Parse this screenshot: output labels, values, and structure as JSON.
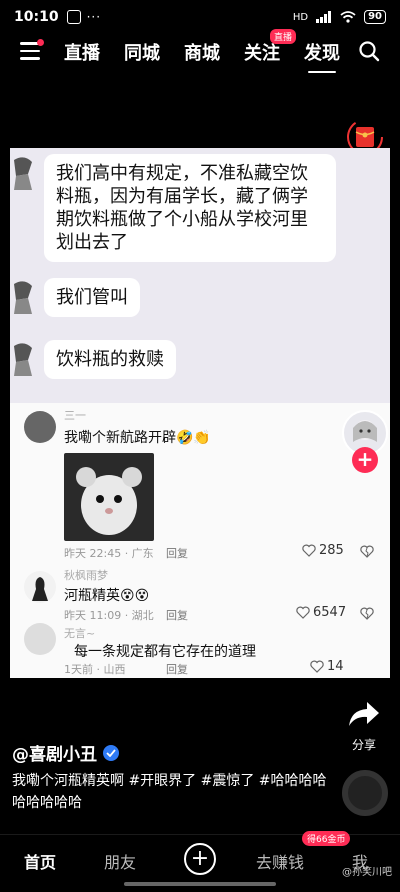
{
  "status": {
    "time": "10:10",
    "battery": "90",
    "signal": "HD"
  },
  "nav": {
    "tabs": [
      "直播",
      "同城",
      "商城",
      "关注",
      "发现"
    ],
    "live_badge": "直播"
  },
  "video": {
    "chat": [
      "我们高中有规定，不准私藏空饮料瓶，因为有届学长，藏了俩学期饮料瓶做了个小船从学校河里划出去了",
      "我们管叫",
      "饮料瓶的救赎"
    ],
    "comments": [
      {
        "user": "三一",
        "text": "我嘞个新航路开辟🤣👏",
        "meta": "昨天 22:45 · 广东",
        "reply": "回复",
        "likes": "285"
      },
      {
        "user": "秋枫雨梦",
        "text": "河瓶精英😵😵",
        "meta": "昨天 11:09 · 湖北",
        "reply": "回复",
        "likes": "6547"
      },
      {
        "user": "无言~",
        "text": "每一条规定都有它存在的道理",
        "meta": "1天前 · 山西",
        "reply": "回复",
        "likes": "14"
      }
    ]
  },
  "side": {
    "share_label": "分享"
  },
  "post": {
    "author": "@喜剧小丑",
    "caption": "我嘞个河瓶精英啊 #开眼界了 #震惊了 #哈哈哈哈哈哈哈哈哈"
  },
  "bottom": {
    "home": "首页",
    "friends": "朋友",
    "earn": "去赚钱",
    "coin_badge": "得66金币",
    "me": "我"
  },
  "watermark": "@孙笑川吧",
  "colors": {
    "accent": "#fe2c55",
    "verified": "#2f7bf6"
  }
}
